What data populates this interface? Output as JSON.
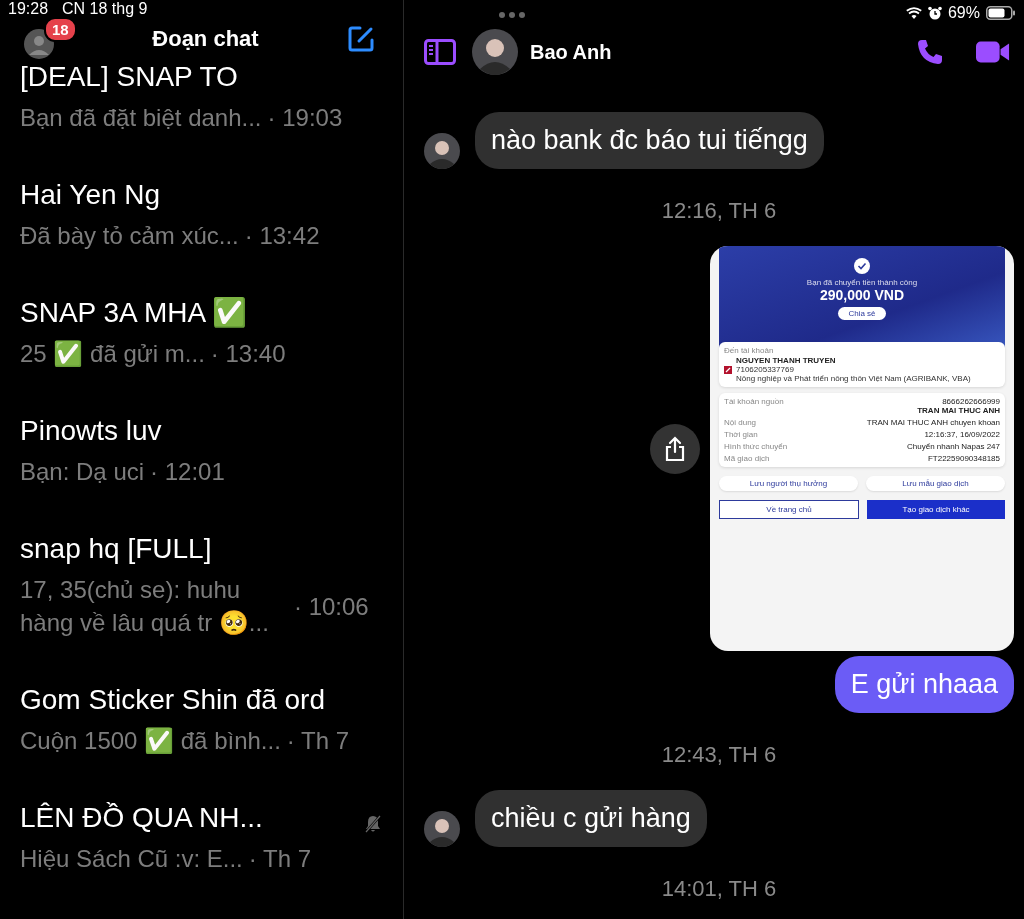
{
  "status_bar": {
    "time": "19:28",
    "date": "CN 18 thg 9",
    "battery": "69%"
  },
  "sidebar": {
    "title": "Đoạn chat",
    "badge": "18",
    "chats": [
      {
        "name": "[DEAL] SNAP TO",
        "preview": "Bạn đã đặt biệt danh...",
        "time": "· 19:03",
        "muted": false
      },
      {
        "name": "Hai Yen Ng",
        "preview": "Đã bày tỏ cảm xúc...",
        "time": "· 13:42",
        "muted": false
      },
      {
        "name": "SNAP 3A MHA ✅",
        "preview": "25 ✅ đã gửi m...",
        "time": "· 13:40",
        "muted": false
      },
      {
        "name": "Pinowts luv",
        "preview": "Bạn: Dạ uci",
        "time": "· 12:01",
        "muted": false
      },
      {
        "name": "snap hq [FULL]",
        "preview": "17, 35(chủ se): huhu hàng về lâu quá tr 🥺...",
        "time": "· 10:06",
        "muted": false
      },
      {
        "name": "Gom Sticker Shin đã ord",
        "preview": "Cuộn 1500 ✅ đã bình...",
        "time": "· Th 7",
        "muted": false
      },
      {
        "name": "LÊN ĐỒ QUA NH...",
        "preview": "Hiệu Sách Cũ :v: E...",
        "time": "· Th 7",
        "muted": true
      }
    ]
  },
  "conversation": {
    "contact": "Bao Anh",
    "messages": [
      {
        "kind": "received",
        "text": "nào bank đc báo tui tiếngg"
      },
      {
        "kind": "timestamp",
        "text": "12:16, TH 6"
      },
      {
        "kind": "image",
        "receipt": {
          "success_text": "Bạn đã chuyển tiền thành công",
          "amount": "290,000 VND",
          "share": "Chia sẻ",
          "to_label": "Đến tài khoản",
          "recipient": "NGUYEN THANH TRUYEN",
          "account": "7106205337769",
          "bank": "Nông nghiệp và Phát triển nông thôn Việt Nam (AGRIBANK, VBA)",
          "details": [
            {
              "label": "Tài khoản nguồn",
              "value": "8666262666999",
              "value_bold": "TRAN MAI THUC ANH"
            },
            {
              "label": "Nội dung",
              "value": "TRAN MAI THUC ANH chuyen khoan"
            },
            {
              "label": "Thời gian",
              "value": "12:16:37, 16/09/2022"
            },
            {
              "label": "Hình thức chuyển",
              "value": "Chuyển nhanh Napas 247"
            },
            {
              "label": "Mã giao dịch",
              "value": "FT22259090348185"
            }
          ],
          "save_buttons": [
            "Lưu người thụ hưởng",
            "Lưu mẫu giao dịch"
          ],
          "home_button": "Về trang chủ",
          "new_button": "Tạo giao dịch khác"
        }
      },
      {
        "kind": "sent",
        "text": "E gửi nhaaa"
      },
      {
        "kind": "timestamp",
        "text": "12:43, TH 6"
      },
      {
        "kind": "received",
        "text": "chiều c gửi hàng"
      },
      {
        "kind": "timestamp",
        "text": "14:01, TH 6"
      }
    ]
  }
}
